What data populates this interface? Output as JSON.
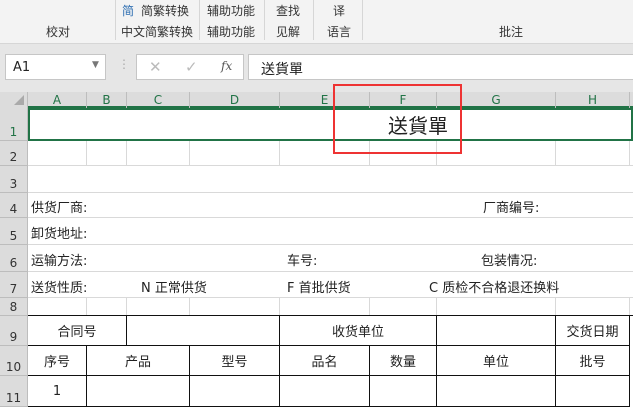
{
  "ribbon": {
    "top_items": [
      "简繁转换",
      "辅助功能",
      "查找",
      "译"
    ],
    "groups": [
      "校对",
      "中文简繁转换",
      "辅助功能",
      "见解",
      "语言",
      "批注"
    ],
    "simplified_icon": "简"
  },
  "formula_bar": {
    "name_box": "A1",
    "cancel": "✕",
    "enter": "✓",
    "fx": "fx",
    "value": "送貨單"
  },
  "columns": [
    "A",
    "B",
    "C",
    "D",
    "E",
    "F",
    "G",
    "H"
  ],
  "rows": [
    "1",
    "2",
    "3",
    "4",
    "5",
    "6",
    "7",
    "8",
    "9",
    "10",
    "11"
  ],
  "sheet": {
    "title": "送貨單",
    "supplier": "供货厂商:",
    "supplier_no": "厂商编号:",
    "unload_addr": "卸货地址:",
    "transport": "运输方法:",
    "car_no": "车号:",
    "packing": "包装情况:",
    "nature": "送货性质:",
    "opt_n": "N 正常供货",
    "opt_f": "F  首批供货",
    "opt_c": "C  质检不合格退还换料",
    "contract_no": "合同号",
    "receiver": "收货单位",
    "delivery_date": "交货日期",
    "headers": {
      "seq": "序号",
      "product": "产品",
      "model": "型号",
      "name": "品名",
      "qty": "数量",
      "unit": "单位",
      "batch": "批号"
    },
    "row1_seq": "1"
  },
  "colors": {
    "accent": "#217346",
    "highlight": "#ee3333"
  }
}
